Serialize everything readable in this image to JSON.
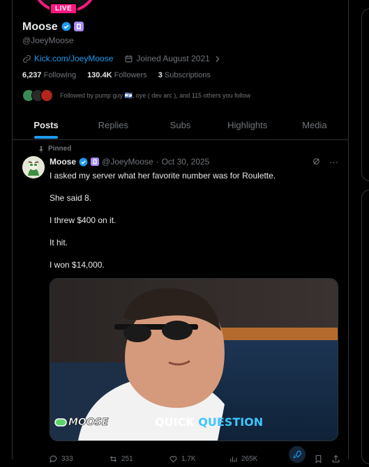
{
  "profile": {
    "live_badge": "LIVE",
    "name": "Moose",
    "handle": "@JoeyMoose",
    "link": "Kick.com/JoeyMoose",
    "joined": "Joined August 2021",
    "following_count": "6,237",
    "following_label": "Following",
    "followers_count": "130.4K",
    "followers_label": "Followers",
    "subscriptions_count": "3",
    "subscriptions_label": "Subscriptions",
    "followed_by": "Followed by pump guy 🇮🇱, oye ( dev arc ), and 115 others you follow"
  },
  "tabs": [
    {
      "label": "Posts",
      "active": true
    },
    {
      "label": "Replies"
    },
    {
      "label": "Subs"
    },
    {
      "label": "Highlights"
    },
    {
      "label": "Media"
    }
  ],
  "post": {
    "pinned_label": "Pinned",
    "author": "Moose",
    "handle": "@JoeyMoose",
    "date": "Oct 30, 2025",
    "lines": [
      "I asked my server what her favorite number was for Roulette.",
      "She said 8.",
      "I threw $400 on it.",
      "It hit.",
      "I won $14,000."
    ],
    "media_caption_left": "MOOSE",
    "media_caption_quick": "QUICK",
    "media_caption_question": "QUESTION",
    "replies": "333",
    "reposts": "251",
    "likes": "1.7K",
    "views": "265K"
  },
  "colors": {
    "accent": "#1d9bf0",
    "live": "#f91880",
    "muted": "#71767b"
  }
}
